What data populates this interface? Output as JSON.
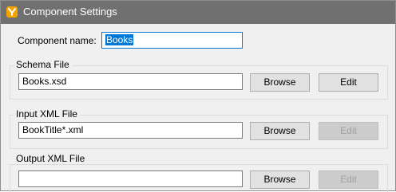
{
  "window": {
    "title": "Component Settings",
    "icon": "mapforce-app-icon",
    "accent_color": "#f4a300"
  },
  "component_name": {
    "label": "Component name:",
    "value": "Books"
  },
  "schema_file": {
    "group_title": "Schema File",
    "path": "Books.xsd",
    "browse_label": "Browse",
    "edit_label": "Edit"
  },
  "input_xml_file": {
    "group_title": "Input XML File",
    "path": "BookTitle*.xml",
    "browse_label": "Browse",
    "edit_label": "Edit"
  },
  "output_xml_file": {
    "group_title": "Output XML File",
    "path": "",
    "browse_label": "Browse",
    "edit_label": "Edit"
  }
}
